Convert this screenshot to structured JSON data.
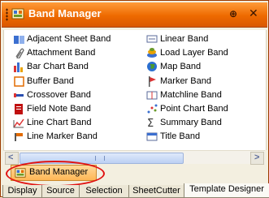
{
  "panel": {
    "title": "Band Manager",
    "pin_icon": "pin-icon",
    "pin_glyph": "⊕",
    "close_icon": "close-icon",
    "close_glyph": "✕"
  },
  "bands_left": [
    {
      "label": "Adjacent Sheet Band",
      "icon": "adjacent-sheet-band-icon"
    },
    {
      "label": "Attachment Band",
      "icon": "attachment-band-icon"
    },
    {
      "label": "Bar Chart Band",
      "icon": "bar-chart-band-icon"
    },
    {
      "label": "Buffer Band",
      "icon": "buffer-band-icon"
    },
    {
      "label": "Crossover Band",
      "icon": "crossover-band-icon"
    },
    {
      "label": "Field Note Band",
      "icon": "field-note-band-icon"
    },
    {
      "label": "Line Chart Band",
      "icon": "line-chart-band-icon"
    },
    {
      "label": "Line Marker Band",
      "icon": "line-marker-band-icon"
    }
  ],
  "bands_right": [
    {
      "label": "Linear Band",
      "icon": "linear-band-icon"
    },
    {
      "label": "Load Layer Band",
      "icon": "load-layer-band-icon"
    },
    {
      "label": "Map Band",
      "icon": "map-band-icon"
    },
    {
      "label": "Marker Band",
      "icon": "marker-band-icon"
    },
    {
      "label": "Matchline Band",
      "icon": "matchline-band-icon"
    },
    {
      "label": "Point Chart Band",
      "icon": "point-chart-band-icon"
    },
    {
      "label": "Summary Band",
      "icon": "summary-band-icon"
    },
    {
      "label": "Title Band",
      "icon": "title-band-icon"
    }
  ],
  "scroll": {
    "left_glyph": "<",
    "right_glyph": ">"
  },
  "docked_tab": {
    "label": "Band Manager",
    "icon": "band-manager-icon"
  },
  "bottom_tabs": [
    {
      "label": "Display",
      "active": false
    },
    {
      "label": "Source",
      "active": false
    },
    {
      "label": "Selection",
      "active": false
    },
    {
      "label": "SheetCutter",
      "active": false
    },
    {
      "label": "Template Designer",
      "active": true
    }
  ],
  "colors": {
    "titlebar": "#ee6a00",
    "highlight_circle": "#e01212",
    "tab_highlight": "#ffb655"
  }
}
